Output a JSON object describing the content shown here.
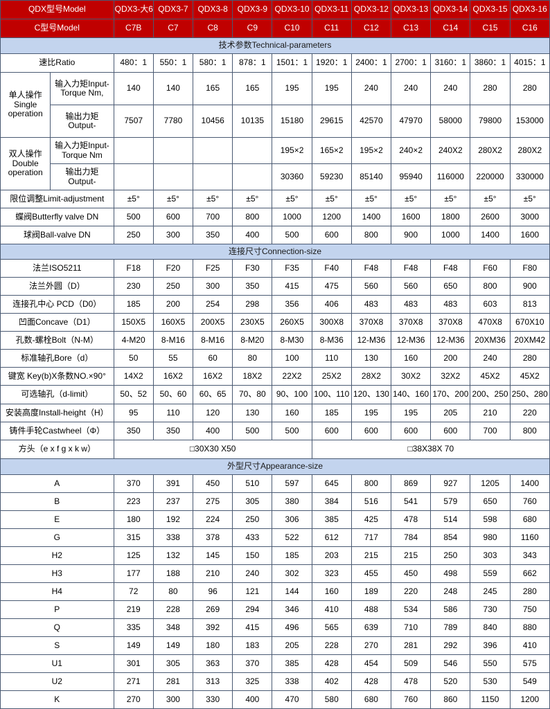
{
  "header": {
    "qdx_label": "QDX型号Model",
    "c_label": "C型号Model",
    "qdx_models": [
      "QDX3-大6",
      "QDX3-7",
      "QDX3-8",
      "QDX3-9",
      "QDX3-10",
      "QDX3-11",
      "QDX3-12",
      "QDX3-13",
      "QDX3-14",
      "QDX3-15",
      "QDX3-16"
    ],
    "c_models": [
      "C7B",
      "C7",
      "C8",
      "C9",
      "C10",
      "C11",
      "C12",
      "C13",
      "C14",
      "C15",
      "C16"
    ]
  },
  "colors": {
    "header_red": "#c00000",
    "section_blue": "#c3d4ee",
    "border": "#4a5a73",
    "text": "#000000"
  },
  "sections": {
    "technical": "技术参数Technical-parameters",
    "connection": "连接尺寸Connection-size",
    "appearance": "外型尺寸Appearance-size"
  },
  "technical": {
    "ratio": {
      "label": "速比Ratio",
      "values": [
        "480：1",
        "550：1",
        "580：1",
        "878：1",
        "1501：1",
        "1920：1",
        "2400：1",
        "2700：1",
        "3160：1",
        "3860：1",
        "4015：1"
      ]
    },
    "single": {
      "group_label": "单人操作 Single operation",
      "input": {
        "label": "输入力矩Input-Torque Nm,",
        "values": [
          "140",
          "140",
          "165",
          "165",
          "195",
          "195",
          "240",
          "240",
          "240",
          "280",
          "280"
        ]
      },
      "output": {
        "label": "输出力矩 Output-",
        "values": [
          "7507",
          "7780",
          "10456",
          "10135",
          "15180",
          "29615",
          "42570",
          "47970",
          "58000",
          "79800",
          "153000"
        ]
      }
    },
    "double": {
      "group_label": "双人操作 Double operation",
      "input": {
        "label": "输入力矩Input-Torque Nm",
        "values": [
          "",
          "",
          "",
          "",
          "195×2",
          "165×2",
          "195×2",
          "240×2",
          "240X2",
          "280X2",
          "280X2"
        ]
      },
      "output": {
        "label": "输出力矩 Output-",
        "values": [
          "",
          "",
          "",
          "",
          "30360",
          "59230",
          "85140",
          "95940",
          "116000",
          "220000",
          "330000"
        ]
      }
    },
    "limit": {
      "label": "限位调整Limit-adjustment",
      "values": [
        "±5°",
        "±5°",
        "±5°",
        "±5°",
        "±5°",
        "±5°",
        "±5°",
        "±5°",
        "±5°",
        "±5°",
        "±5°"
      ]
    },
    "butterfly": {
      "label": "蝶阀Butterfly valve DN",
      "values": [
        "500",
        "600",
        "700",
        "800",
        "1000",
        "1200",
        "1400",
        "1600",
        "1800",
        "2600",
        "3000"
      ]
    },
    "ball": {
      "label": "球阀Ball-valve DN",
      "values": [
        "250",
        "300",
        "350",
        "400",
        "500",
        "600",
        "800",
        "900",
        "1000",
        "1400",
        "1600"
      ]
    }
  },
  "connection": {
    "rows": [
      {
        "label": "法兰ISO5211",
        "values": [
          "F18",
          "F20",
          "F25",
          "F30",
          "F35",
          "F40",
          "F48",
          "F48",
          "F48",
          "F60",
          "F80"
        ]
      },
      {
        "label": "法兰外圆（D）",
        "values": [
          "230",
          "250",
          "300",
          "350",
          "415",
          "475",
          "560",
          "560",
          "650",
          "800",
          "900"
        ]
      },
      {
        "label": "连接孔中心 PCD（D0）",
        "values": [
          "185",
          "200",
          "254",
          "298",
          "356",
          "406",
          "483",
          "483",
          "483",
          "603",
          "813"
        ]
      },
      {
        "label": "凹面Concave（D1）",
        "values": [
          "150X5",
          "160X5",
          "200X5",
          "230X5",
          "260X5",
          "300X8",
          "370X8",
          "370X8",
          "370X8",
          "470X8",
          "670X10"
        ]
      },
      {
        "label": "孔数-螺栓Bolt（N-M）",
        "values": [
          "4-M20",
          "8-M16",
          "8-M16",
          "8-M20",
          "8-M30",
          "8-M36",
          "12-M36",
          "12-M36",
          "12-M36",
          "20XM36",
          "20XM42"
        ]
      },
      {
        "label": "标准轴孔Bore（d）",
        "values": [
          "50",
          "55",
          "60",
          "80",
          "100",
          "110",
          "130",
          "160",
          "200",
          "240",
          "280"
        ]
      },
      {
        "label": "键宽 Key(b)X条数NO.×90°",
        "values": [
          "14X2",
          "16X2",
          "16X2",
          "18X2",
          "22X2",
          "25X2",
          "28X2",
          "30X2",
          "32X2",
          "45X2",
          "45X2"
        ]
      },
      {
        "label": "可选轴孔（d-limit）",
        "values": [
          "50、52",
          "50、60",
          "60、65",
          "70、80",
          "90、100",
          "100、110",
          "120、130",
          "140、160",
          "170、200",
          "200、250",
          "250、280"
        ]
      },
      {
        "label": "安装高度Install-height（H）",
        "values": [
          "95",
          "110",
          "120",
          "130",
          "160",
          "185",
          "195",
          "195",
          "205",
          "210",
          "220"
        ]
      },
      {
        "label": "铸件手轮Castwheel（Φ）",
        "values": [
          "350",
          "350",
          "400",
          "500",
          "500",
          "600",
          "600",
          "600",
          "600",
          "700",
          "800"
        ]
      }
    ],
    "square_head": {
      "label": "方头（e x f g x k  w）",
      "left_value": "□30X30 X50",
      "right_value": "□38X38X 70"
    }
  },
  "appearance": {
    "rows": [
      {
        "label": "A",
        "values": [
          "370",
          "391",
          "450",
          "510",
          "597",
          "645",
          "800",
          "869",
          "927",
          "1205",
          "1400"
        ]
      },
      {
        "label": "B",
        "values": [
          "223",
          "237",
          "275",
          "305",
          "380",
          "384",
          "516",
          "541",
          "579",
          "650",
          "760"
        ]
      },
      {
        "label": "E",
        "values": [
          "180",
          "192",
          "224",
          "250",
          "306",
          "385",
          "425",
          "478",
          "514",
          "598",
          "680"
        ]
      },
      {
        "label": "G",
        "values": [
          "315",
          "338",
          "378",
          "433",
          "522",
          "612",
          "717",
          "784",
          "854",
          "980",
          "1160"
        ]
      },
      {
        "label": "H2",
        "values": [
          "125",
          "132",
          "145",
          "150",
          "185",
          "203",
          "215",
          "215",
          "250",
          "303",
          "343"
        ]
      },
      {
        "label": "H3",
        "values": [
          "177",
          "188",
          "210",
          "240",
          "302",
          "323",
          "455",
          "450",
          "498",
          "559",
          "662"
        ]
      },
      {
        "label": "H4",
        "values": [
          "72",
          "80",
          "96",
          "121",
          "144",
          "160",
          "189",
          "220",
          "248",
          "245",
          "280"
        ]
      },
      {
        "label": "P",
        "values": [
          "219",
          "228",
          "269",
          "294",
          "346",
          "410",
          "488",
          "534",
          "586",
          "730",
          "750"
        ]
      },
      {
        "label": "Q",
        "values": [
          "335",
          "348",
          "392",
          "415",
          "496",
          "565",
          "639",
          "710",
          "789",
          "840",
          "880"
        ]
      },
      {
        "label": "S",
        "values": [
          "149",
          "149",
          "180",
          "183",
          "205",
          "228",
          "270",
          "281",
          "292",
          "396",
          "410"
        ]
      },
      {
        "label": "U1",
        "values": [
          "301",
          "305",
          "363",
          "370",
          "385",
          "428",
          "454",
          "509",
          "546",
          "550",
          "575"
        ]
      },
      {
        "label": "U2",
        "values": [
          "271",
          "281",
          "313",
          "325",
          "338",
          "402",
          "428",
          "478",
          "520",
          "530",
          "549"
        ]
      },
      {
        "label": "K",
        "values": [
          "270",
          "300",
          "330",
          "400",
          "470",
          "580",
          "680",
          "760",
          "860",
          "1150",
          "1200"
        ]
      }
    ]
  }
}
